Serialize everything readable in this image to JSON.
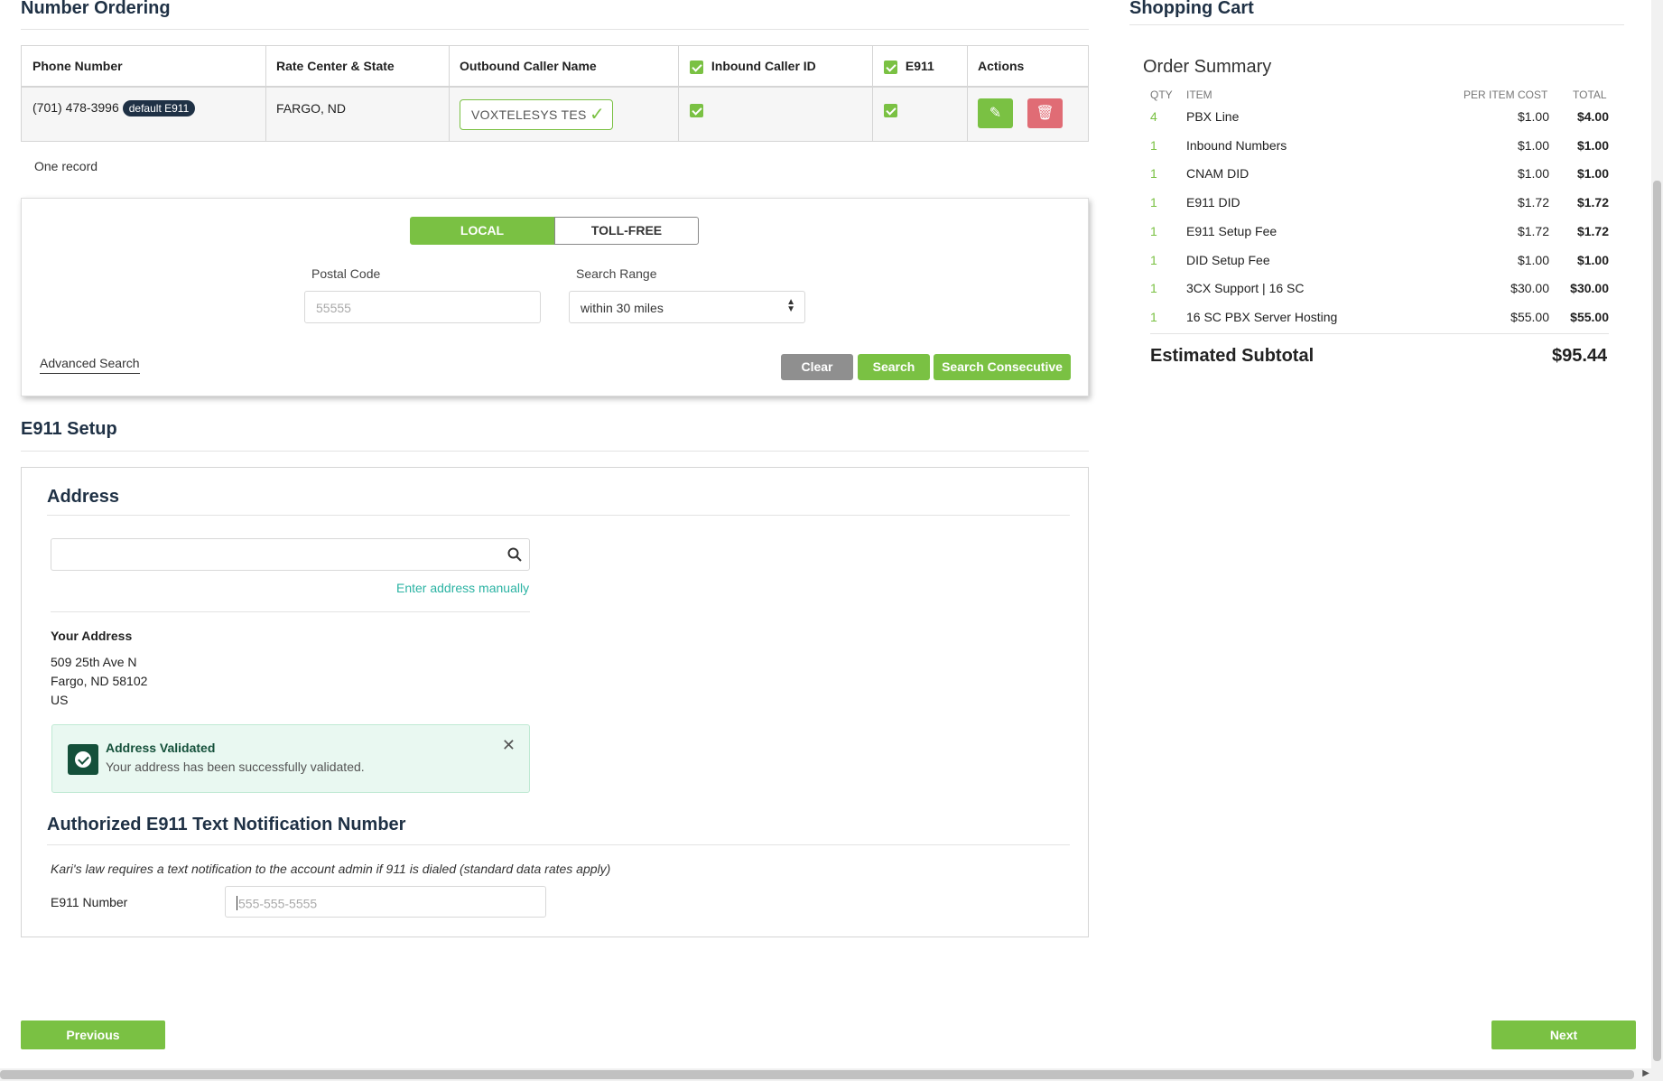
{
  "number_ordering": {
    "title": "Number Ordering",
    "columns": {
      "phone": "Phone Number",
      "rate_center": "Rate Center & State",
      "caller_name": "Outbound Caller Name",
      "inbound_id": "Inbound Caller ID",
      "e911": "E911",
      "actions": "Actions"
    },
    "rows": [
      {
        "phone": "(701) 478-3996",
        "badge": "default E911",
        "rate_center": "FARGO, ND",
        "caller_name": "VOXTELESYS TES"
      }
    ],
    "record_count": "One record"
  },
  "search": {
    "tab_local": "LOCAL",
    "tab_tollfree": "TOLL-FREE",
    "postal_label": "Postal Code",
    "postal_placeholder": "55555",
    "range_label": "Search Range",
    "range_value": "within 30 miles",
    "advanced": "Advanced Search",
    "clear": "Clear",
    "search": "Search",
    "search_consecutive": "Search Consecutive"
  },
  "e911": {
    "title": "E911 Setup",
    "address_title": "Address",
    "address_search_placeholder": "",
    "enter_manually": "Enter address manually",
    "your_address_label": "Your Address",
    "address_line1": "509 25th Ave N",
    "address_line2": "Fargo, ND 58102",
    "address_line3": "US",
    "alert_title": "Address Validated",
    "alert_message": "Your address has been successfully validated.",
    "notif_title": "Authorized E911 Text Notification Number",
    "notif_note": "Kari's law requires a text notification to the account admin if 911 is dialed (standard data rates apply)",
    "number_label": "E911 Number",
    "number_placeholder": "555-555-5555"
  },
  "cart": {
    "title": "Shopping Cart",
    "summary_title": "Order Summary",
    "headers": {
      "qty": "QTY",
      "item": "ITEM",
      "per_item": "PER ITEM COST",
      "total": "TOTAL"
    },
    "items": [
      {
        "qty": "4",
        "item": "PBX Line",
        "cost": "$1.00",
        "total": "$4.00"
      },
      {
        "qty": "1",
        "item": "Inbound Numbers",
        "cost": "$1.00",
        "total": "$1.00"
      },
      {
        "qty": "1",
        "item": "CNAM DID",
        "cost": "$1.00",
        "total": "$1.00"
      },
      {
        "qty": "1",
        "item": "E911 DID",
        "cost": "$1.72",
        "total": "$1.72"
      },
      {
        "qty": "1",
        "item": "E911 Setup Fee",
        "cost": "$1.72",
        "total": "$1.72"
      },
      {
        "qty": "1",
        "item": "DID Setup Fee",
        "cost": "$1.00",
        "total": "$1.00"
      },
      {
        "qty": "1",
        "item": "3CX Support | 16 SC",
        "cost": "$30.00",
        "total": "$30.00"
      },
      {
        "qty": "1",
        "item": "16 SC PBX Server Hosting",
        "cost": "$55.00",
        "total": "$55.00"
      }
    ],
    "subtotal_label": "Estimated Subtotal",
    "subtotal_value": "$95.44"
  },
  "nav": {
    "previous": "Previous",
    "next": "Next"
  },
  "colors": {
    "accent_green": "#7ac143",
    "navy": "#1f3145",
    "danger": "#e06c75",
    "clear_gray": "#8f8f8f"
  }
}
